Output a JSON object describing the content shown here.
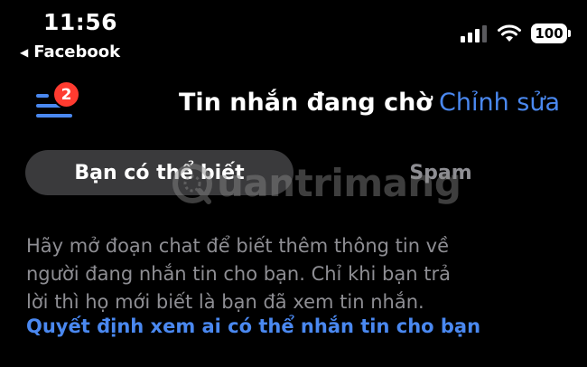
{
  "status_bar": {
    "time": "11:56",
    "back_label": "Facebook",
    "battery": "100",
    "icons": [
      "signal-icon",
      "wifi-icon",
      "battery-icon"
    ]
  },
  "nav": {
    "menu_icon": "menu-lines-icon",
    "badge_count": "2",
    "title": "Tin nhắn đang chờ",
    "edit_label": "Chỉnh sửa"
  },
  "tabs": [
    {
      "label": "Bạn có thể biết",
      "active": true
    },
    {
      "label": "Spam",
      "active": false
    }
  ],
  "watermark": {
    "text": "uantrimang",
    "icon": "quantrimang-logo-icon"
  },
  "info": {
    "lines": [
      "Hãy mở đoạn chat để biết thêm thông tin về",
      "người đang nhắn tin cho bạn. Chỉ khi bạn trả",
      "lời thì họ mới biết là bạn đã xem tin nhắn."
    ],
    "link": "Quyết định xem ai có thể nhắn tin cho bạn"
  },
  "colors": {
    "background": "#000000",
    "accent": "#4a88f0",
    "badge": "#ff3b30",
    "muted_text": "#8e8e93",
    "tab_active_bg": "#3a3a3c"
  }
}
